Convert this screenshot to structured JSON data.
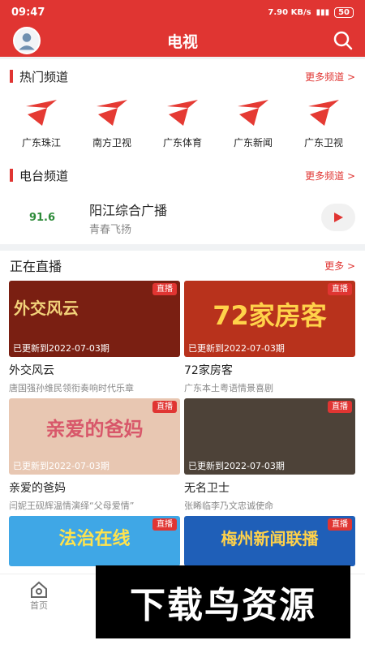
{
  "status": {
    "time": "09:47",
    "signal_text": "7.90 KB/s",
    "battery": "50"
  },
  "header": {
    "title": "电视"
  },
  "hot": {
    "title": "热门频道",
    "more": "更多频道 >",
    "channels": [
      {
        "name": "广东珠江"
      },
      {
        "name": "南方卫视"
      },
      {
        "name": "广东体育"
      },
      {
        "name": "广东新闻"
      },
      {
        "name": "广东卫视"
      }
    ]
  },
  "radio": {
    "title": "电台频道",
    "more": "更多频道 >",
    "logo": "91.6",
    "name": "阳江综合广播",
    "sub": "青春飞扬"
  },
  "live": {
    "title": "正在直播",
    "more": "更多 >"
  },
  "cards": [
    {
      "title": "外交风云",
      "sub": "唐国强孙维民领衔奏响时代乐章",
      "badge": "直播",
      "updated": "已更新到2022-07-03期",
      "thumb_text": "外交风云"
    },
    {
      "title": "72家房客",
      "sub": "广东本土粤语情景喜剧",
      "badge": "直播",
      "updated": "已更新到2022-07-03期",
      "thumb_text": "72家房客"
    },
    {
      "title": "亲爱的爸妈",
      "sub": "闫妮王砚辉温情演绎“父母爱情”",
      "badge": "直播",
      "updated": "已更新到2022-07-03期",
      "thumb_text": "亲爱的爸妈"
    },
    {
      "title": "无名卫士",
      "sub": "张睎临李乃文忠诚使命",
      "badge": "直播",
      "updated": "已更新到2022-07-03期",
      "thumb_text": ""
    },
    {
      "title": "",
      "sub": "",
      "badge": "直播",
      "updated": "",
      "thumb_text": "法治在线"
    },
    {
      "title": "",
      "sub": "",
      "badge": "直播",
      "updated": "",
      "thumb_text": "梅州新闻联播"
    }
  ],
  "tabbar": {
    "home": "首页"
  },
  "watermark": "下载鸟资源"
}
